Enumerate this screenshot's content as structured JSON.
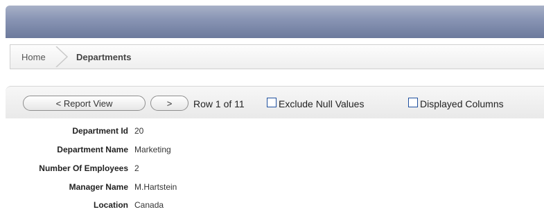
{
  "breadcrumb": {
    "home": "Home",
    "current": "Departments"
  },
  "toolbar": {
    "report_view_label": "< Report View",
    "next_label": ">",
    "row_text": "Row 1 of 11",
    "exclude_null_label": "Exclude Null Values",
    "displayed_columns_label": "Displayed Columns",
    "exclude_null_checked": false,
    "displayed_columns_checked": false
  },
  "details": [
    {
      "label": "Department Id",
      "value": "20"
    },
    {
      "label": "Department Name",
      "value": "Marketing"
    },
    {
      "label": "Number Of Employees",
      "value": "2"
    },
    {
      "label": "Manager Name",
      "value": "M.Hartstein"
    },
    {
      "label": "Location",
      "value": "Canada"
    }
  ],
  "colors": {
    "header_top": "#a8b1c8",
    "header_bottom": "#6c7a9c",
    "checkbox_border": "#1f4f9e"
  }
}
